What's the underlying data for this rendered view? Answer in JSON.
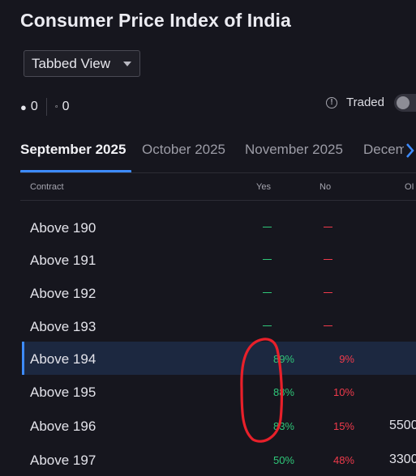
{
  "page": {
    "title": "Consumer Price Index of India"
  },
  "view_select": {
    "value": "Tabbed View"
  },
  "counters": {
    "filled": "0",
    "hollow": "0"
  },
  "traded": {
    "label": "Traded",
    "enabled": false
  },
  "tabs": [
    {
      "label": "September 2025",
      "active": true
    },
    {
      "label": "October 2025",
      "active": false
    },
    {
      "label": "November 2025",
      "active": false
    },
    {
      "label": "Decem",
      "active": false
    }
  ],
  "table": {
    "columns": [
      "Contract",
      "Yes",
      "No",
      "OI"
    ],
    "rows": [
      {
        "contract": "Above 190",
        "yes": "",
        "no": "",
        "oi": ""
      },
      {
        "contract": "Above 191",
        "yes": "",
        "no": "",
        "oi": ""
      },
      {
        "contract": "Above 192",
        "yes": "",
        "no": "",
        "oi": ""
      },
      {
        "contract": "Above 193",
        "yes": "",
        "no": "",
        "oi": ""
      },
      {
        "contract": "Above 194",
        "yes": "89%",
        "no": "9%",
        "oi": ""
      },
      {
        "contract": "Above 195",
        "yes": "88%",
        "no": "10%",
        "oi": ""
      },
      {
        "contract": "Above 196",
        "yes": "83%",
        "no": "15%",
        "oi": "5500"
      },
      {
        "contract": "Above 197",
        "yes": "50%",
        "no": "48%",
        "oi": "3300"
      }
    ]
  },
  "colors": {
    "background": "#16161e",
    "accent": "#3d8bff",
    "yes": "#2fc779",
    "no": "#f03a4b",
    "annotation": "#e8202a"
  }
}
